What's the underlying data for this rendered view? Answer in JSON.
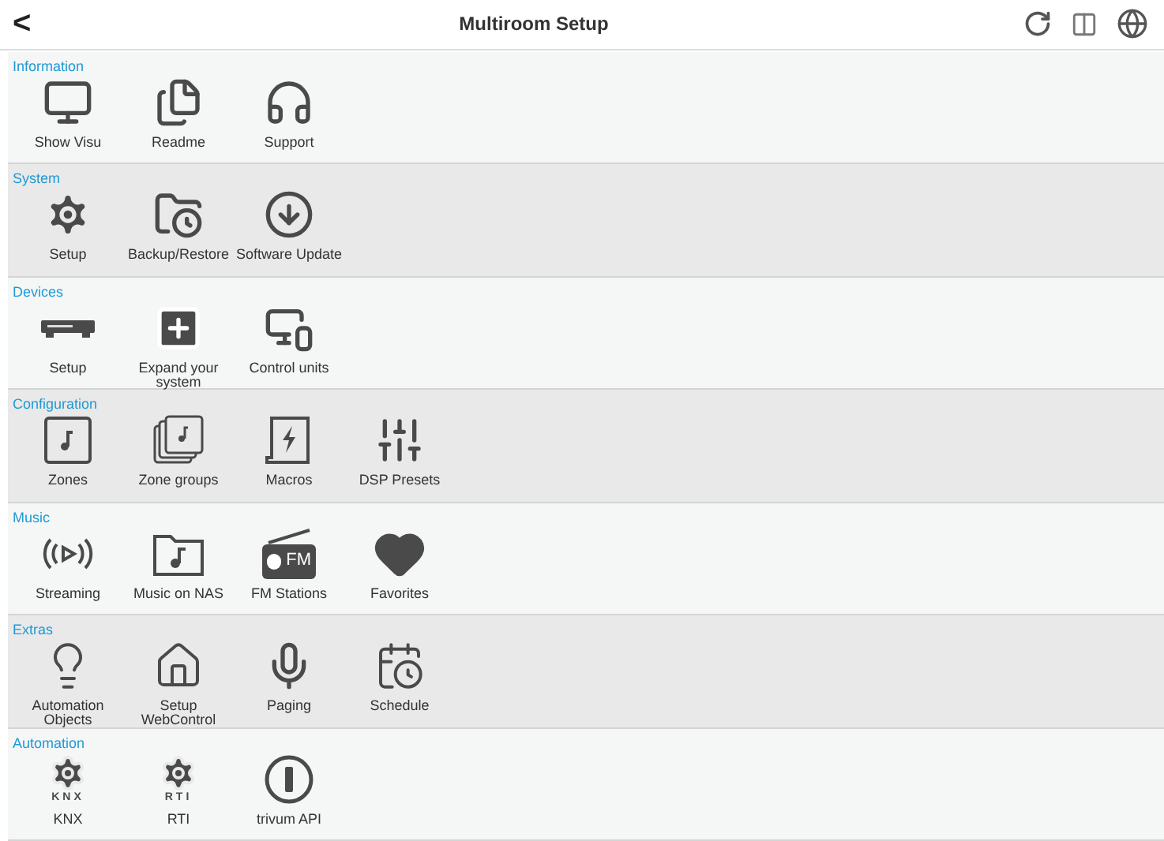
{
  "header": {
    "back": "<",
    "title": "Multiroom Setup"
  },
  "sections": [
    {
      "title": "Information",
      "items": [
        {
          "label": "Show Visu"
        },
        {
          "label": "Readme"
        },
        {
          "label": "Support"
        }
      ]
    },
    {
      "title": "System",
      "items": [
        {
          "label": "Setup"
        },
        {
          "label": "Backup/Restore"
        },
        {
          "label": "Software Update"
        }
      ]
    },
    {
      "title": "Devices",
      "items": [
        {
          "label": "Setup"
        },
        {
          "label": "Expand your system"
        },
        {
          "label": "Control units"
        }
      ]
    },
    {
      "title": "Configuration",
      "items": [
        {
          "label": "Zones"
        },
        {
          "label": "Zone groups"
        },
        {
          "label": "Macros"
        },
        {
          "label": "DSP Presets"
        }
      ]
    },
    {
      "title": "Music",
      "items": [
        {
          "label": "Streaming"
        },
        {
          "label": "Music on NAS"
        },
        {
          "label": "FM Stations",
          "icon_text": "FM"
        },
        {
          "label": "Favorites"
        }
      ]
    },
    {
      "title": "Extras",
      "items": [
        {
          "label": "Automation Objects"
        },
        {
          "label": "Setup WebControl"
        },
        {
          "label": "Paging"
        },
        {
          "label": "Schedule"
        }
      ]
    },
    {
      "title": "Automation",
      "items": [
        {
          "label": "KNX",
          "icon_text": "KNX"
        },
        {
          "label": "RTI",
          "icon_text": "RTI"
        },
        {
          "label": "trivum API"
        }
      ]
    }
  ]
}
